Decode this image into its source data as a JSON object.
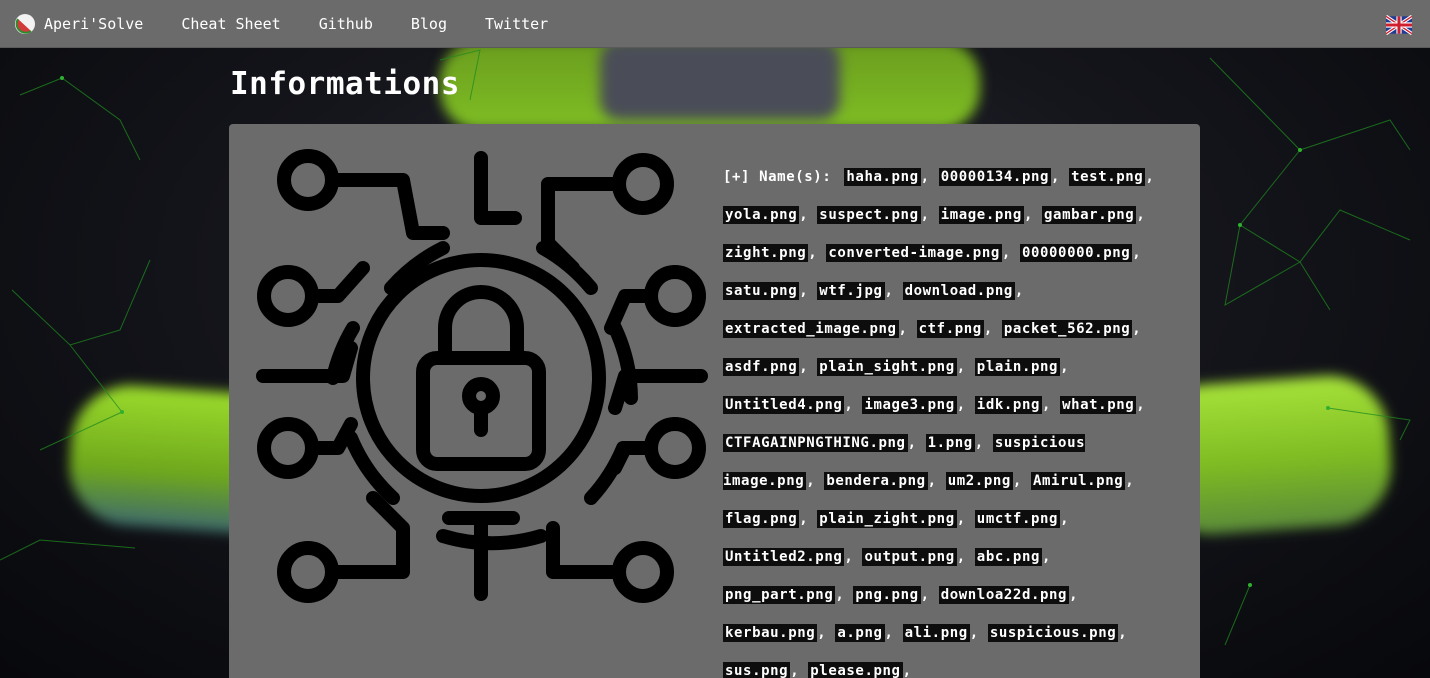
{
  "navbar": {
    "brand": "Aperi'Solve",
    "links": [
      "Cheat Sheet",
      "Github",
      "Blog",
      "Twitter"
    ],
    "flag_icon": "uk-flag-icon"
  },
  "page": {
    "section_title": "Informations"
  },
  "info": {
    "icon": "cyber-lock-icon",
    "names_label": "[+] Name(s):",
    "names": [
      "haha.png",
      "00000134.png",
      "test.png",
      "yola.png",
      "suspect.png",
      "image.png",
      "gambar.png",
      "zight.png",
      "converted-image.png",
      "00000000.png",
      "satu.png",
      "wtf.jpg",
      "download.png",
      "extracted_image.png",
      "ctf.png",
      "packet_562.png",
      "asdf.png",
      "plain_sight.png",
      "plain.png",
      "Untitled4.png",
      "image3.png",
      "idk.png",
      "what.png",
      "CTFAGAINPNGTHING.png",
      "1.png",
      "suspicious image.png",
      "bendera.png",
      "um2.png",
      "Amirul.png",
      "flag.png",
      "plain_zight.png",
      "umctf.png",
      "Untitled2.png",
      "output.png",
      "abc.png",
      "png_part.png",
      "png.png",
      "downloa22d.png",
      "kerbau.png",
      "a.png",
      "ali.png",
      "suspicious.png",
      "sus.png",
      "please.png"
    ]
  },
  "colors": {
    "navbar_bg": "#6b6b6b",
    "panel_bg": "#6b6b6b",
    "filename_bg": "#0d0d0d",
    "accent_green": "#8fd12a"
  }
}
